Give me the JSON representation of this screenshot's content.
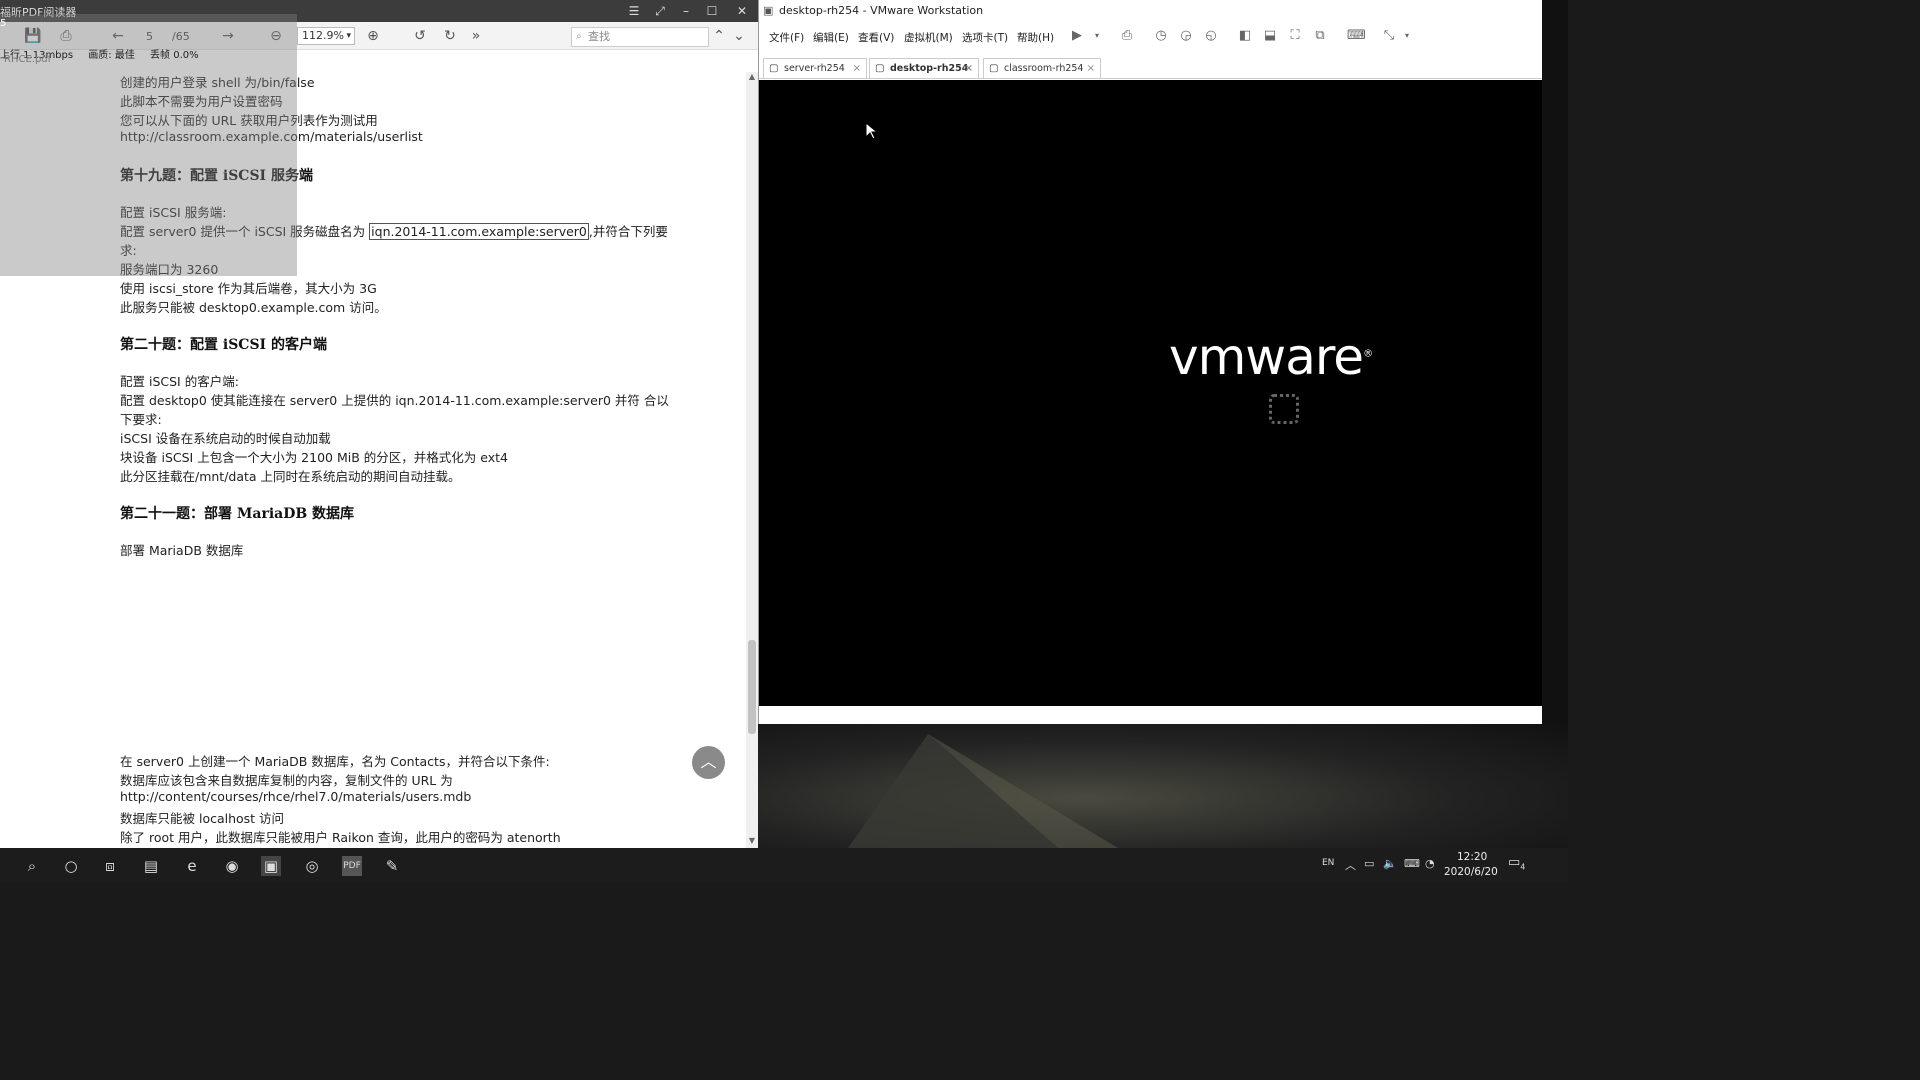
{
  "pdf": {
    "window_title": "福昕PDF阅读器",
    "page_current": "5",
    "page_total": "/65",
    "zoom": "112.9%",
    "search_placeholder": "查找",
    "lines": [
      "创建的用户登录 shell 为/bin/false",
      "此脚本不需要为用户设置密码",
      "您可以从下面的 URL 获取用户列表作为测试用",
      "http://classroom.example.com/materials/userlist"
    ],
    "q19": {
      "heading": "第十九题：配置 iSCSI 服务端",
      "l1": "配置 iSCSI 服务端:",
      "l2_pre": "配置 server0 提供一个 iSCSI 服务磁盘名为",
      "l2_boxed": "iqn.2014-11.com.example:server0",
      "l2_post": ",并符合下列要",
      "l3": "求:",
      "l4": "服务端口为 3260",
      "l5": "使用 iscsi_store 作为其后端卷，其大小为 3G",
      "l6": "此服务只能被 desktop0.example.com 访问。"
    },
    "q20": {
      "heading": "第二十题：配置 iSCSI 的客户端",
      "l1": "配置 iSCSI 的客户端:",
      "l2": "配置 desktop0 使其能连接在 server0 上提供的 iqn.2014-11.com.example:server0 并符  合以",
      "l3": "下要求:",
      "l4": "iSCSI 设备在系统启动的时候自动加载",
      "l5": "块设备 iSCSI 上包含一个大小为 2100 MiB 的分区，并格式化为 ext4",
      "l6": "此分区挂载在/mnt/data 上同时在系统启动的期间自动挂载。"
    },
    "q21": {
      "heading": "第二十一题：部署 MariaDB 数据库",
      "l1": "部署 MariaDB 数据库",
      "b1": "在  server0  上创建一个  MariaDB  数据库，名为  Contacts，并符合以下条件:",
      "b2": "数据库应该包含来自数据库复制的内容，复制文件的 URL 为",
      "b3": "http://content/courses/rhce/rhel7.0/materials/users.mdb",
      "b4": "数据库只能被  localhost  访问",
      "b5": "除了  root  用户，此数据库只能被用户  Raikon  查询，此用户的密码为  atenorth"
    }
  },
  "overlay": {
    "app": "5",
    "upload": "上行  1.13mbps",
    "quality": "画质: 最佳",
    "loss": "丢帧 0.0%",
    "tab": "RHCE.pdf"
  },
  "vmware": {
    "window_title": "desktop-rh254 - VMware Workstation",
    "menu": [
      "文件(F)",
      "编辑(E)",
      "查看(V)",
      "虚拟机(M)",
      "选项卡(T)",
      "帮助(H)"
    ],
    "tabs": [
      "server-rh254",
      "desktop-rh254",
      "classroom-rh254"
    ],
    "logo": "vmware"
  },
  "taskbar": {
    "lang": "EN",
    "time": "12:20",
    "date": "2020/6/20",
    "notif": "4"
  }
}
